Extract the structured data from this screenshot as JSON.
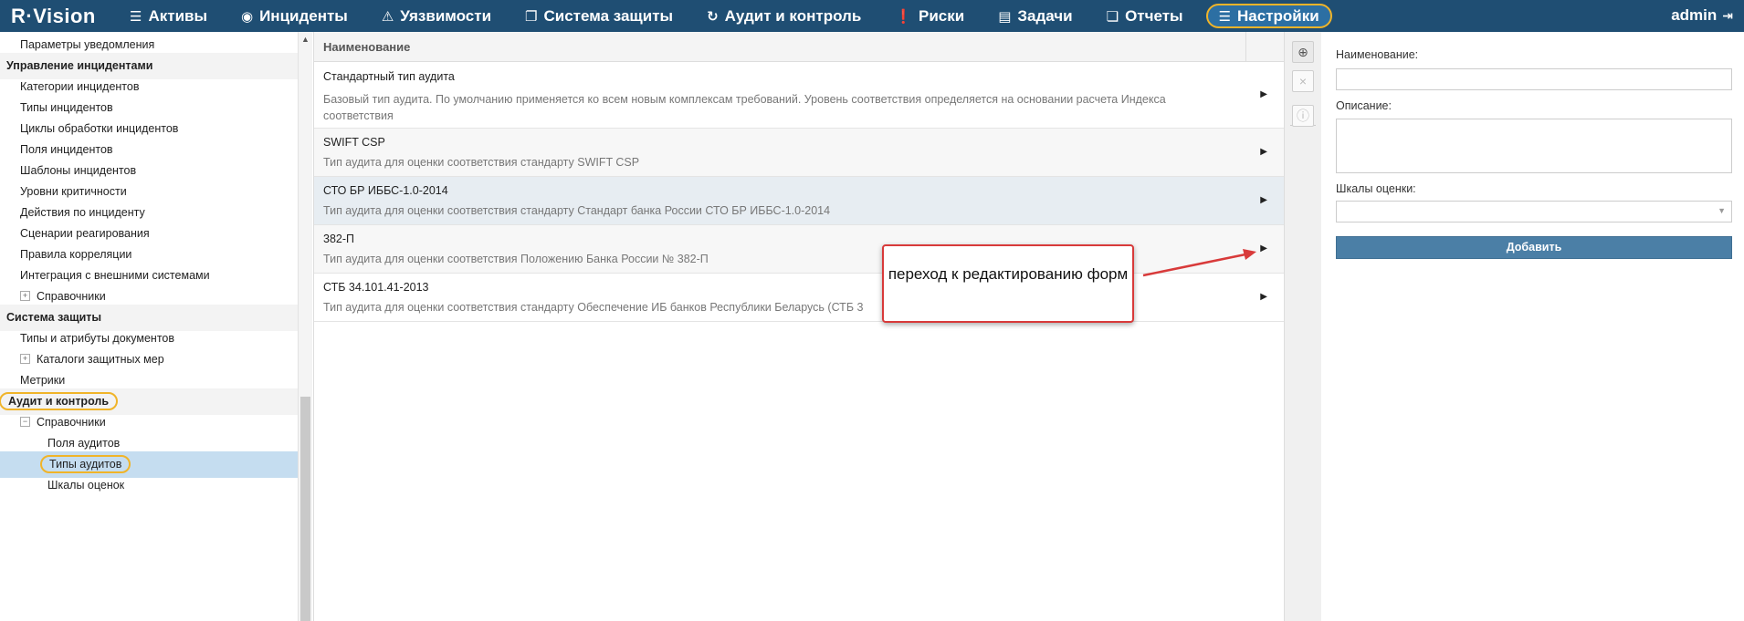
{
  "app": {
    "logo": "R·Vision"
  },
  "nav": [
    {
      "label": "Активы",
      "icon": "database-icon",
      "glyph": "☰"
    },
    {
      "label": "Инциденты",
      "icon": "target-icon",
      "glyph": "◉"
    },
    {
      "label": "Уязвимости",
      "icon": "warning-icon",
      "glyph": "⚠"
    },
    {
      "label": "Система защиты",
      "icon": "windows-icon",
      "glyph": "❐"
    },
    {
      "label": "Аудит и контроль",
      "icon": "cycle-icon",
      "glyph": "↻"
    },
    {
      "label": "Риски",
      "icon": "alert-icon",
      "glyph": "❗"
    },
    {
      "label": "Задачи",
      "icon": "tasks-icon",
      "glyph": "▤"
    },
    {
      "label": "Отчеты",
      "icon": "reports-icon",
      "glyph": "❏"
    },
    {
      "label": "Настройки",
      "icon": "menu-icon",
      "glyph": "☰",
      "active": true
    }
  ],
  "user": {
    "name": "admin",
    "logout_glyph": "⇥"
  },
  "sidebar": [
    {
      "label": "Параметры уведомления",
      "level": 1
    },
    {
      "label": "Управление инцидентами",
      "level": 0
    },
    {
      "label": "Категории инцидентов",
      "level": 1
    },
    {
      "label": "Типы инцидентов",
      "level": 1
    },
    {
      "label": "Циклы обработки инцидентов",
      "level": 1
    },
    {
      "label": "Поля инцидентов",
      "level": 1
    },
    {
      "label": "Шаблоны инцидентов",
      "level": 1
    },
    {
      "label": "Уровни критичности",
      "level": 1
    },
    {
      "label": "Действия по инциденту",
      "level": 1
    },
    {
      "label": "Сценарии реагирования",
      "level": 1
    },
    {
      "label": "Правила корреляции",
      "level": 1
    },
    {
      "label": "Интеграция с внешними системами",
      "level": 1
    },
    {
      "label": "Справочники",
      "level": 1,
      "expander": "+"
    },
    {
      "label": "Система защиты",
      "level": 0
    },
    {
      "label": "Типы и атрибуты документов",
      "level": 1
    },
    {
      "label": "Каталоги защитных мер",
      "level": 1,
      "expander": "+"
    },
    {
      "label": "Метрики",
      "level": 1
    },
    {
      "label": "Аудит и контроль",
      "level": 0,
      "circled": true
    },
    {
      "label": "Справочники",
      "level": 1,
      "expander": "−"
    },
    {
      "label": "Поля аудитов",
      "level": 2
    },
    {
      "label": "Типы аудитов",
      "level": 2,
      "selected": true,
      "circled": true
    },
    {
      "label": "Шкалы оценок",
      "level": 2
    }
  ],
  "list": {
    "header": "Наименование",
    "rows": [
      {
        "title": "Стандартный тип аудита",
        "desc": "Базовый тип аудита. По умолчанию применяется ко всем новым комплексам требований. Уровень соответствия определяется на основании расчета Индекса соответствия"
      },
      {
        "title": "SWIFT CSP",
        "desc": "Тип аудита для оценки соответствия стандарту SWIFT CSP"
      },
      {
        "title": "СТО БР ИББС-1.0-2014",
        "desc": "Тип аудита для оценки соответствия стандарту Стандарт банка России СТО БР ИББС-1.0-2014"
      },
      {
        "title": "382-П",
        "desc": "Тип аудита для оценки соответствия Положению Банка России № 382-П"
      },
      {
        "title": "СТБ 34.101.41-2013",
        "desc": "Тип аудита для оценки соответствия стандарту Обеспечение ИБ банков Республики Беларусь (СТБ 3"
      }
    ]
  },
  "callout": {
    "text": "переход к редактированию форм"
  },
  "toolbar": {
    "add_glyph": "⊕",
    "delete_glyph": "×",
    "info_glyph": "ⓘ"
  },
  "form": {
    "name_label": "Наименование:",
    "name_value": "",
    "desc_label": "Описание:",
    "desc_value": "",
    "scales_label": "Шкалы оценки:",
    "scales_value": "",
    "submit_label": "Добавить"
  },
  "colors": {
    "topbar": "#1f4e73",
    "highlight": "#f0b429",
    "callout_border": "#d83a3a",
    "button": "#4b7fa6",
    "selected_row": "#c5ddf0"
  }
}
